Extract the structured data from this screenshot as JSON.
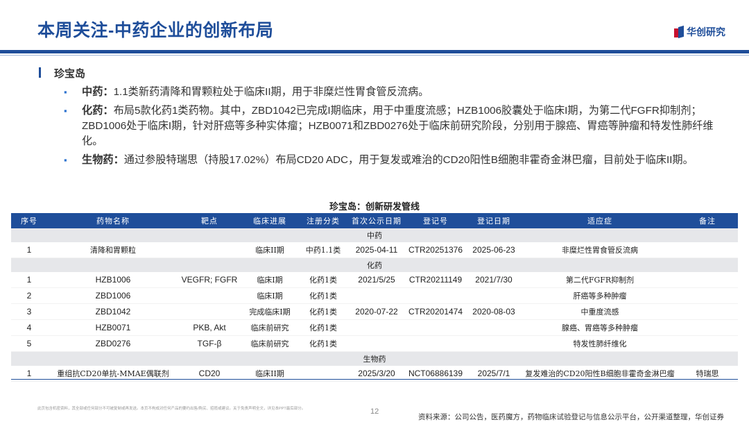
{
  "header": {
    "title": "本周关注-中药企业的创新布局",
    "logo_text": "华创研究"
  },
  "section": {
    "title": "珍宝岛",
    "bullets": [
      {
        "label": "中药：",
        "text": "1.1类新药清降和胃颗粒处于临床II期，用于非糜烂性胃食管反流病。"
      },
      {
        "label": "化药：",
        "text": "布局5款化药1类药物。其中，ZBD1042已完成I期临床，用于中重度流感；HZB1006胶囊处于临床I期，为第二代FGFR抑制剂；ZBD1006处于临床I期，针对肝癌等多种实体瘤；HZB0071和ZBD0276处于临床前研究阶段，分别用于腺癌、胃癌等肿瘤和特发性肺纤维化。"
      },
      {
        "label": "生物药：",
        "text": "通过参股特瑞思（持股17.02%）布局CD20 ADC，用于复发或难治的CD20阳性B细胞非霍奇金淋巴瘤，目前处于临床II期。"
      }
    ]
  },
  "table": {
    "title": "珍宝岛：创新研发管线",
    "headers": [
      "序号",
      "药物名称",
      "靶点",
      "临床进展",
      "注册分类",
      "首次公示日期",
      "登记号",
      "登记日期",
      "适应症",
      "备注"
    ],
    "groups": [
      {
        "category": "中药",
        "rows": [
          [
            "1",
            "清降和胃颗粒",
            "",
            "临床II期",
            "中药1.1类",
            "2025-04-11",
            "CTR20251376",
            "2025-06-23",
            "非糜烂性胃食管反流病",
            ""
          ]
        ]
      },
      {
        "category": "化药",
        "rows": [
          [
            "1",
            "HZB1006",
            "VEGFR; FGFR",
            "临床I期",
            "化药1类",
            "2021/5/25",
            "CTR20211149",
            "2021/7/30",
            "第二代FGFR抑制剂",
            ""
          ],
          [
            "2",
            "ZBD1006",
            "",
            "临床I期",
            "化药1类",
            "",
            "",
            "",
            "肝癌等多种肿瘤",
            ""
          ],
          [
            "3",
            "ZBD1042",
            "",
            "完成临床I期",
            "化药1类",
            "2020-07-22",
            "CTR20201474",
            "2020-08-03",
            "中重度流感",
            ""
          ],
          [
            "4",
            "HZB0071",
            "PKB, Akt",
            "临床前研究",
            "化药1类",
            "",
            "",
            "",
            "腺癌、胃癌等多种肿瘤",
            ""
          ],
          [
            "5",
            "ZBD0276",
            "TGF-β",
            "临床前研究",
            "化药1类",
            "",
            "",
            "",
            "特发性肺纤维化",
            ""
          ]
        ]
      },
      {
        "category": "生物药",
        "rows": [
          [
            "1",
            "重组抗CD20单抗-MMAE偶联剂",
            "CD20",
            "临床II期",
            "",
            "2025/3/20",
            "NCT06886139",
            "2025/7/1",
            "复发难治的CD20阳性B细胞非霍奇金淋巴瘤",
            "特瑞思"
          ]
        ]
      }
    ]
  },
  "footer": {
    "disclaimer": "此页包含机密资料，其全部或任何部分不可被复制或再发送。本页不构成对任何产品的要约出售/购买、招揽或建议。关于免责声明全文，详见本PPT最后部分。",
    "page_number": "12",
    "source": "资料来源：公司公告，医药魔方，药物临床试验登记与信息公示平台，公开渠道整理，华创证券"
  },
  "colors": {
    "brand_blue": "#1f4e9a",
    "brand_red": "#c8102e",
    "bullet_blue": "#2f74d0",
    "category_row_bg": "#e6e7ea"
  }
}
